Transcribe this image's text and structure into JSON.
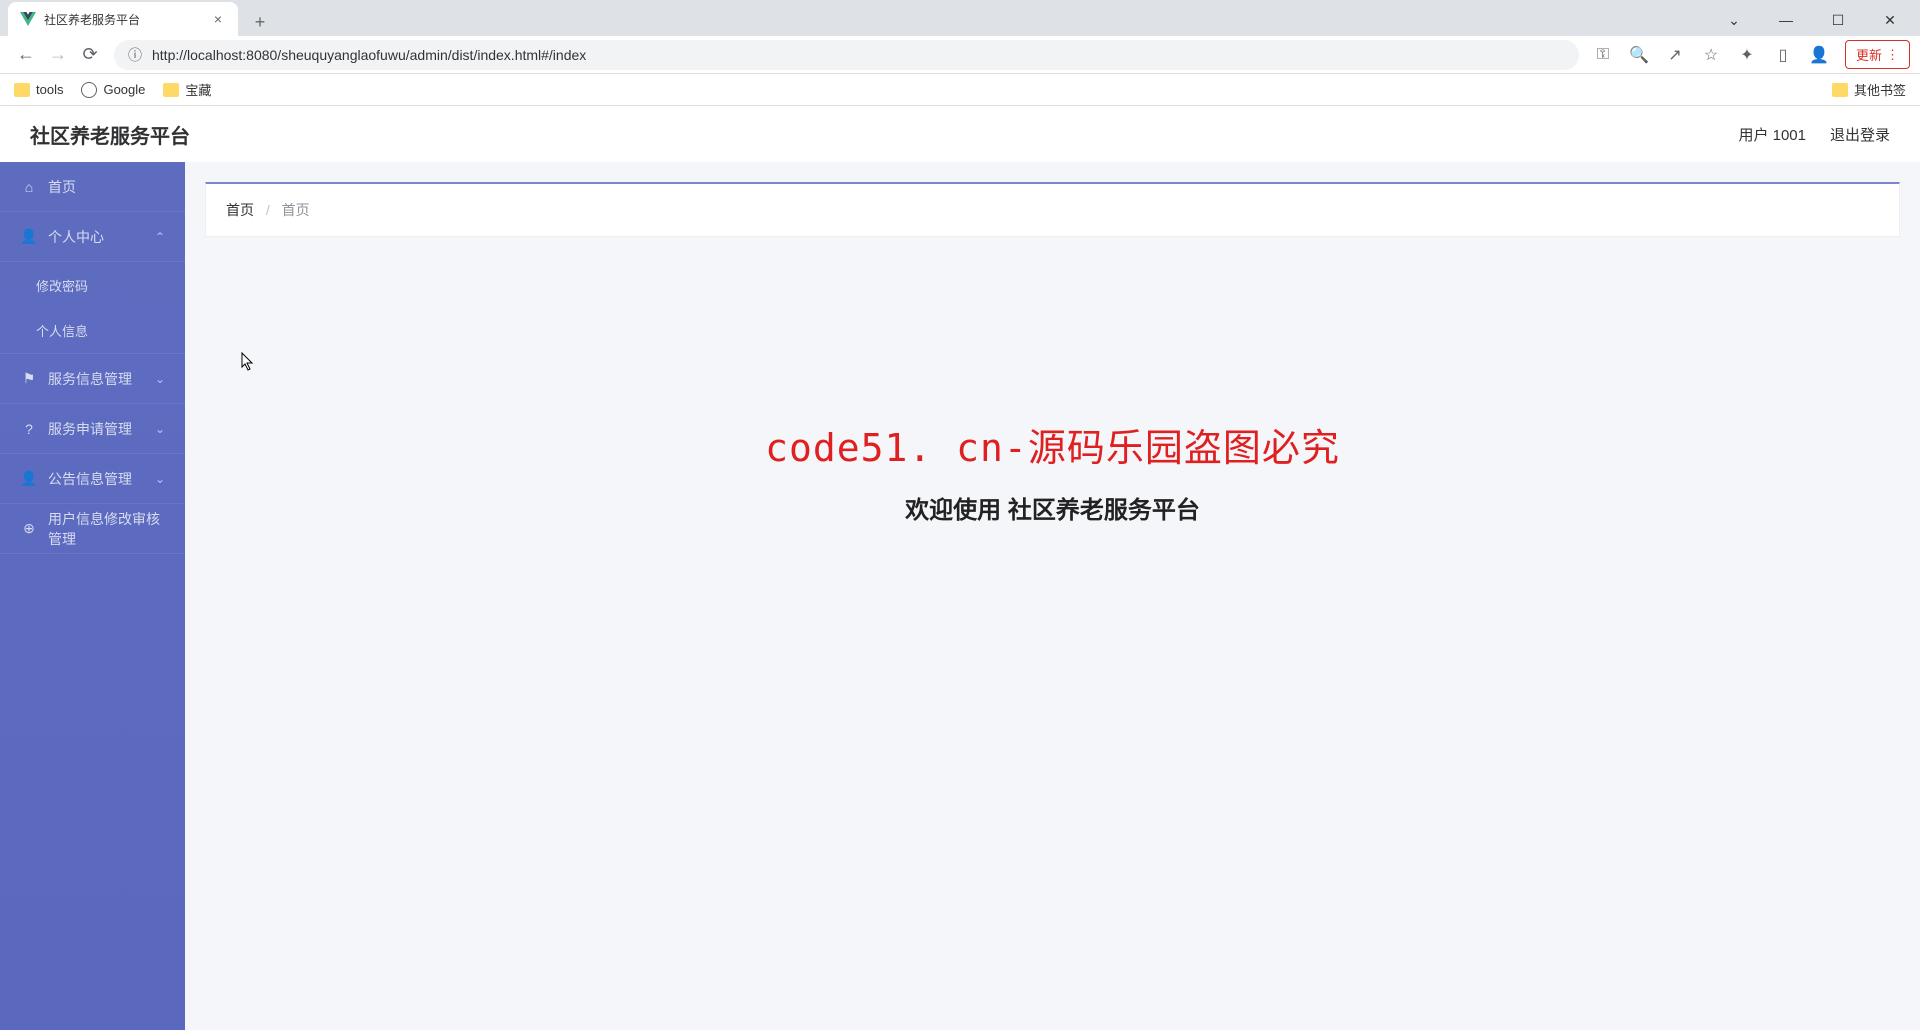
{
  "browser": {
    "tab_title": "社区养老服务平台",
    "url": "http://localhost:8080/sheuquyanglaofuwu/admin/dist/index.html#/index",
    "update_label": "更新",
    "bookmarks": {
      "tools": "tools",
      "google": "Google",
      "baozang": "宝藏",
      "other": "其他书签"
    }
  },
  "header": {
    "app_title": "社区养老服务平台",
    "user_label": "用户 1001",
    "logout_label": "退出登录"
  },
  "sidebar": {
    "home": "首页",
    "personal_center": "个人中心",
    "change_password": "修改密码",
    "personal_info": "个人信息",
    "service_info_mgmt": "服务信息管理",
    "service_apply_mgmt": "服务申请管理",
    "notice_mgmt": "公告信息管理",
    "user_info_audit_mgmt": "用户信息修改审核管理"
  },
  "breadcrumb": {
    "home": "首页",
    "current": "首页"
  },
  "content": {
    "red_text": "code51. cn-源码乐园盗图必究",
    "welcome_text": "欢迎使用 社区养老服务平台"
  },
  "watermark_text": "code51.cn"
}
